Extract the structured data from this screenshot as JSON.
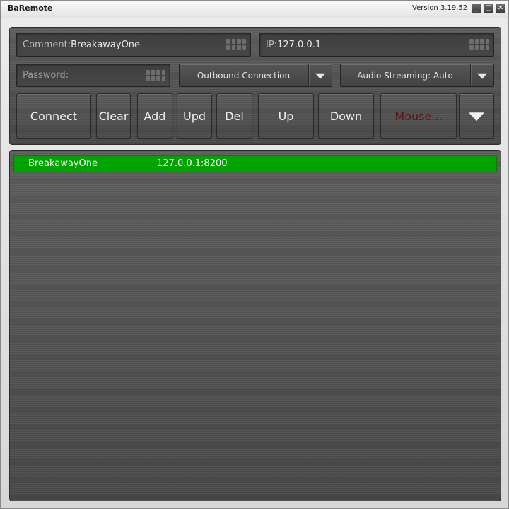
{
  "window": {
    "title": "BaRemote",
    "version": "Version 3.19.52",
    "minimize_glyph": "_",
    "maximize_glyph": "□",
    "close_glyph": "✕"
  },
  "fields": {
    "comment_prefix": "Comment:",
    "comment_value": "BreakawayOne",
    "ip_prefix": "IP:",
    "ip_value": "127.0.0.1",
    "password_placeholder": "Password:"
  },
  "dropdowns": {
    "connection_mode": "Outbound Connection",
    "audio_streaming": "Audio Streaming: Auto"
  },
  "buttons": {
    "connect": "Connect",
    "clear": "Clear",
    "add": "Add",
    "upd": "Upd",
    "del": "Del",
    "up": "Up",
    "down": "Down",
    "mouse": "Mouse..."
  },
  "connections": [
    {
      "name": "BreakawayOne",
      "address": "127.0.0.1:8200",
      "status_color": "#00a300"
    }
  ],
  "icons": {
    "keyboard": "keyboard-icon",
    "dropdown": "chevron-down-icon"
  }
}
